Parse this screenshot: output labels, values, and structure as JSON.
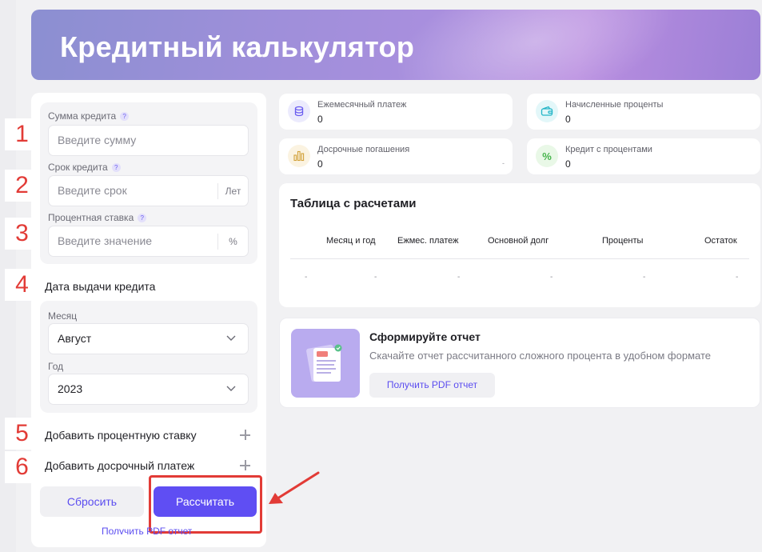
{
  "header": {
    "title": "Кредитный калькулятор"
  },
  "form": {
    "amount": {
      "label": "Сумма кредита",
      "help": "?",
      "placeholder": "Введите сумму"
    },
    "term": {
      "label": "Срок кредита",
      "help": "?",
      "placeholder": "Введите срок",
      "suffix": "Лет"
    },
    "rate": {
      "label": "Процентная ставка",
      "help": "?",
      "placeholder": "Введите значение",
      "suffix": "%"
    },
    "issue_date": {
      "title": "Дата выдачи кредита",
      "month_label": "Месяц",
      "month_value": "Август",
      "year_label": "Год",
      "year_value": "2023"
    },
    "add_rate": "Добавить процентную ставку",
    "add_prepayment": "Добавить досрочный платеж",
    "reset_label": "Сбросить",
    "calculate_label": "Рассчитать",
    "pdf_link": "Получить PDF отчет"
  },
  "annotations": [
    "1",
    "2",
    "3",
    "4",
    "5",
    "6"
  ],
  "stats": [
    {
      "label": "Ежемесячный платеж",
      "value": "0",
      "icon": "coins-icon",
      "color": "#6a5cf0"
    },
    {
      "label": "Начисленные проценты",
      "value": "0",
      "icon": "wallet-icon",
      "color": "#22b5c7"
    },
    {
      "label": "Досрочные погашения",
      "value": "0",
      "extra": "-",
      "icon": "bar-chart-icon",
      "color": "#d2a13a"
    },
    {
      "label": "Кредит с процентами",
      "value": "0",
      "icon": "percent-icon",
      "color": "#44b34a"
    }
  ],
  "table": {
    "title": "Таблица с расчетами",
    "columns": [
      "Месяц и год",
      "Ежмес. платеж",
      "Основной долг",
      "Проценты",
      "Остаток"
    ],
    "row": [
      "-",
      "-",
      "-",
      "-",
      "-",
      "-"
    ]
  },
  "report": {
    "title": "Сформируйте отчет",
    "subtitle": "Скачайте отчет рассчитанного сложного процента в удобном формате",
    "button": "Получить PDF отчет"
  },
  "colors": {
    "accent": "#5f4ef3",
    "annotation": "#e23b36"
  }
}
